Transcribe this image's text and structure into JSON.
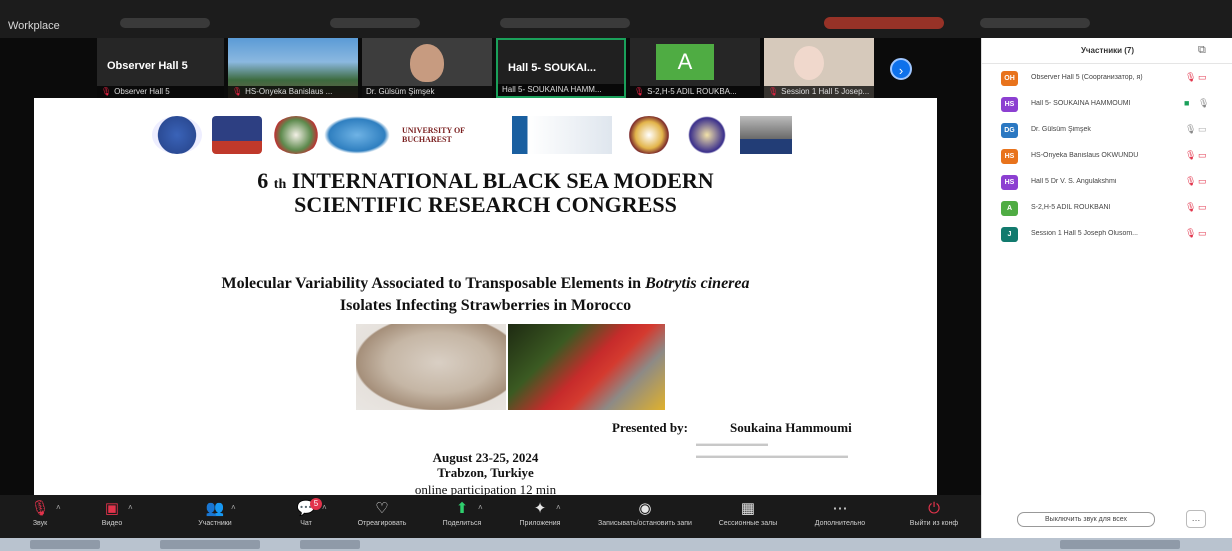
{
  "os_bar": {
    "app_title": "Workplace"
  },
  "thumbnails": [
    {
      "big_label": "Observer Hall 5",
      "caption": "Observer Hall 5"
    },
    {
      "big_label": "",
      "caption": "HS-Onyeka Banislaus ..."
    },
    {
      "big_label": "",
      "caption": "Dr. Gülsüm Şimşek"
    },
    {
      "big_label": "Hall 5- SOUKAI...",
      "caption": "Hall 5- SOUKAINA HAMM..."
    },
    {
      "big_label": "",
      "avatar_letter": "A",
      "caption": "S-2,H-5 ADIL ROUKBA..."
    },
    {
      "big_label": "",
      "caption": "Session 1 Hall 5 Josep..."
    }
  ],
  "slide": {
    "logo_label": "UNIVERSITY OF BUCHAREST",
    "title_prefix": "6",
    "title_sup": "th",
    "title_line1_rest": "INTERNATIONAL BLACK SEA MODERN",
    "title_line2": "SCIENTIFIC RESEARCH CONGRESS",
    "paper_line1_a": "Molecular Variability Associated to Transposable Elements in",
    "paper_line1_italic": "Botrytis cinerea",
    "paper_line2": "Isolates Infecting Strawberries in Morocco",
    "presented_by": "Presented by:",
    "presenter": "Soukaina Hammoumi",
    "date": "August 23-25, 2024",
    "place": "Trabzon, Turkiye",
    "online": "online participation 12 min"
  },
  "toolbar": [
    {
      "icon": "mic-off-icon",
      "glyph": "🎙",
      "label": "Звук",
      "red": true
    },
    {
      "icon": "video-off-icon",
      "glyph": "▣",
      "label": "Видео",
      "red": true
    },
    {
      "icon": "participants-icon",
      "glyph": "👥",
      "label": "Участники"
    },
    {
      "icon": "chat-icon",
      "glyph": "💬",
      "label": "Чат",
      "badge": "5"
    },
    {
      "icon": "react-icon",
      "glyph": "♡",
      "label": "Отреагировать"
    },
    {
      "icon": "share-icon",
      "glyph": "⬆",
      "label": "Поделиться",
      "green": true
    },
    {
      "icon": "apps-icon",
      "glyph": "✦",
      "label": "Приложения"
    },
    {
      "icon": "record-icon",
      "glyph": "◉",
      "label": "Записывать/остановить запи"
    },
    {
      "icon": "breakout-icon",
      "glyph": "▦",
      "label": "Сессионные залы"
    },
    {
      "icon": "more-icon",
      "glyph": "⋯",
      "label": "Дополнительно"
    },
    {
      "icon": "leave-icon",
      "glyph": "⏻",
      "label": "Выйти из конф",
      "red": true
    }
  ],
  "panel": {
    "title": "Участники (7)",
    "participants": [
      {
        "initials": "OH",
        "color": "#e8731c",
        "name": "Observer Hall 5 (Соорганизатор, я)",
        "mic_on": false,
        "cam_on": false
      },
      {
        "initials": "HS",
        "color": "#8c3fd1",
        "name": "Hall 5- SOUKAINA HAMMOUMI",
        "mic_on": true,
        "cam_on": true
      },
      {
        "initials": "DG",
        "color": "#2b78c2",
        "name": "Dr. Gülsüm Şimşek",
        "mic_on": true,
        "cam_on": false
      },
      {
        "initials": "HS",
        "color": "#e8731c",
        "name": "HS-Onyeka Banislaus OKWUNDU",
        "mic_on": false,
        "cam_on": false
      },
      {
        "initials": "HS",
        "color": "#8c3fd1",
        "name": "Hall 5 Dr V. S. Angulakshmi",
        "mic_on": false,
        "cam_on": false
      },
      {
        "initials": "A",
        "color": "#4fac43",
        "name": "S-2,H-5 ADIL ROUKBANI",
        "mic_on": false,
        "cam_on": false
      },
      {
        "initials": "J",
        "color": "#127a6e",
        "name": "Session 1 Hall 5 Joseph Olusom...",
        "mic_on": false,
        "cam_on": false
      }
    ],
    "mute_all_label": "Выключить звук для всех",
    "more_label": "…"
  }
}
